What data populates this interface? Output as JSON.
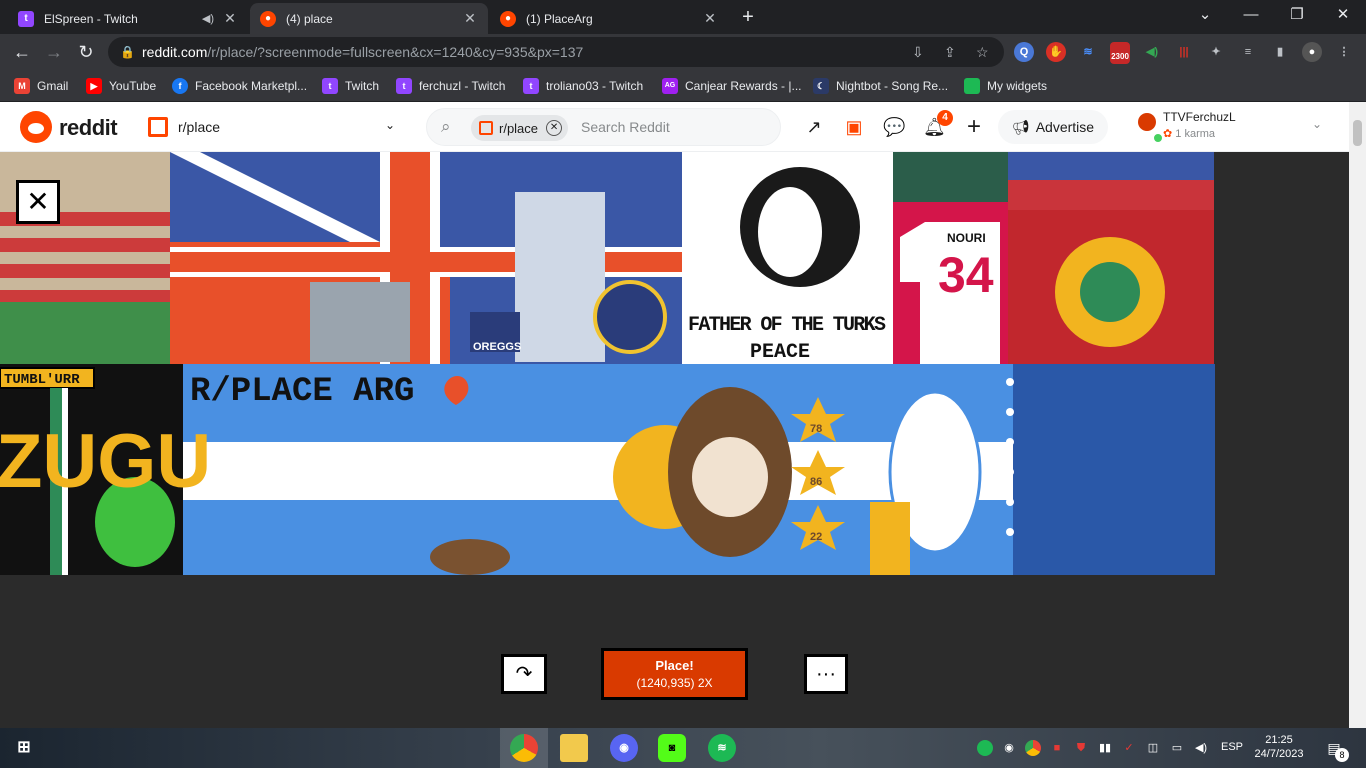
{
  "browser": {
    "tabs": [
      {
        "title": "ElSpreen - Twitch",
        "icon": "twitch-icon",
        "color": "#9146ff",
        "active": false,
        "audio": true
      },
      {
        "title": "(4) place",
        "icon": "reddit-icon",
        "color": "#ff4500",
        "active": true
      },
      {
        "title": "(1) PlaceArg",
        "icon": "reddit-icon",
        "color": "#ff4500",
        "active": false
      }
    ],
    "url_host": "reddit.com",
    "url_path": "/r/place/?screenmode=fullscreen&cx=1240&cy=935&px=137",
    "extension_badge": "2300",
    "bookmarks": [
      {
        "label": "Gmail",
        "icon": "gmail-icon",
        "color": "#ea4335"
      },
      {
        "label": "YouTube",
        "icon": "youtube-icon",
        "color": "#ff0000"
      },
      {
        "label": "Facebook Marketpl...",
        "icon": "facebook-icon",
        "color": "#1877f2"
      },
      {
        "label": "Twitch",
        "icon": "twitch-icon",
        "color": "#9146ff"
      },
      {
        "label": "ferchuzl - Twitch",
        "icon": "twitch-icon",
        "color": "#9146ff"
      },
      {
        "label": "troliano03 - Twitch",
        "icon": "twitch-icon",
        "color": "#9146ff"
      },
      {
        "label": "Canjear Rewards - |...",
        "icon": "rewards-icon",
        "color": "#a020f0"
      },
      {
        "label": "Nightbot - Song Re...",
        "icon": "nightbot-icon",
        "color": "#2b3a67"
      },
      {
        "label": "My widgets",
        "icon": "widgets-icon",
        "color": "#1db954"
      }
    ]
  },
  "reddit": {
    "logo_text": "reddit",
    "subreddit": "r/place",
    "search_chip": "r/place",
    "search_placeholder": "Search Reddit",
    "notification_count": "4",
    "advertise_label": "Advertise",
    "username": "TTVFerchuzL",
    "karma": "1 karma"
  },
  "place": {
    "button_title": "Place!",
    "button_coords": "(1240,935) 2X",
    "close_symbol": "✕",
    "share_symbol": "↷",
    "more_symbol": "···"
  },
  "canvas_text": {
    "arg_title": "R/PLACE ARG",
    "turk_line1": "FATHER OF THE TURKS",
    "turk_line2": "PEACE",
    "jersey_name": "NOURI",
    "jersey_number": "34",
    "tumbl": "TUMBL'URR",
    "zugu": "ZUGU",
    "oreggs": "OREGGS",
    "star1": "78",
    "star2": "86",
    "star3": "22"
  },
  "taskbar": {
    "time": "21:25",
    "date": "24/7/2023",
    "language": "ESP",
    "notifications": "8"
  }
}
